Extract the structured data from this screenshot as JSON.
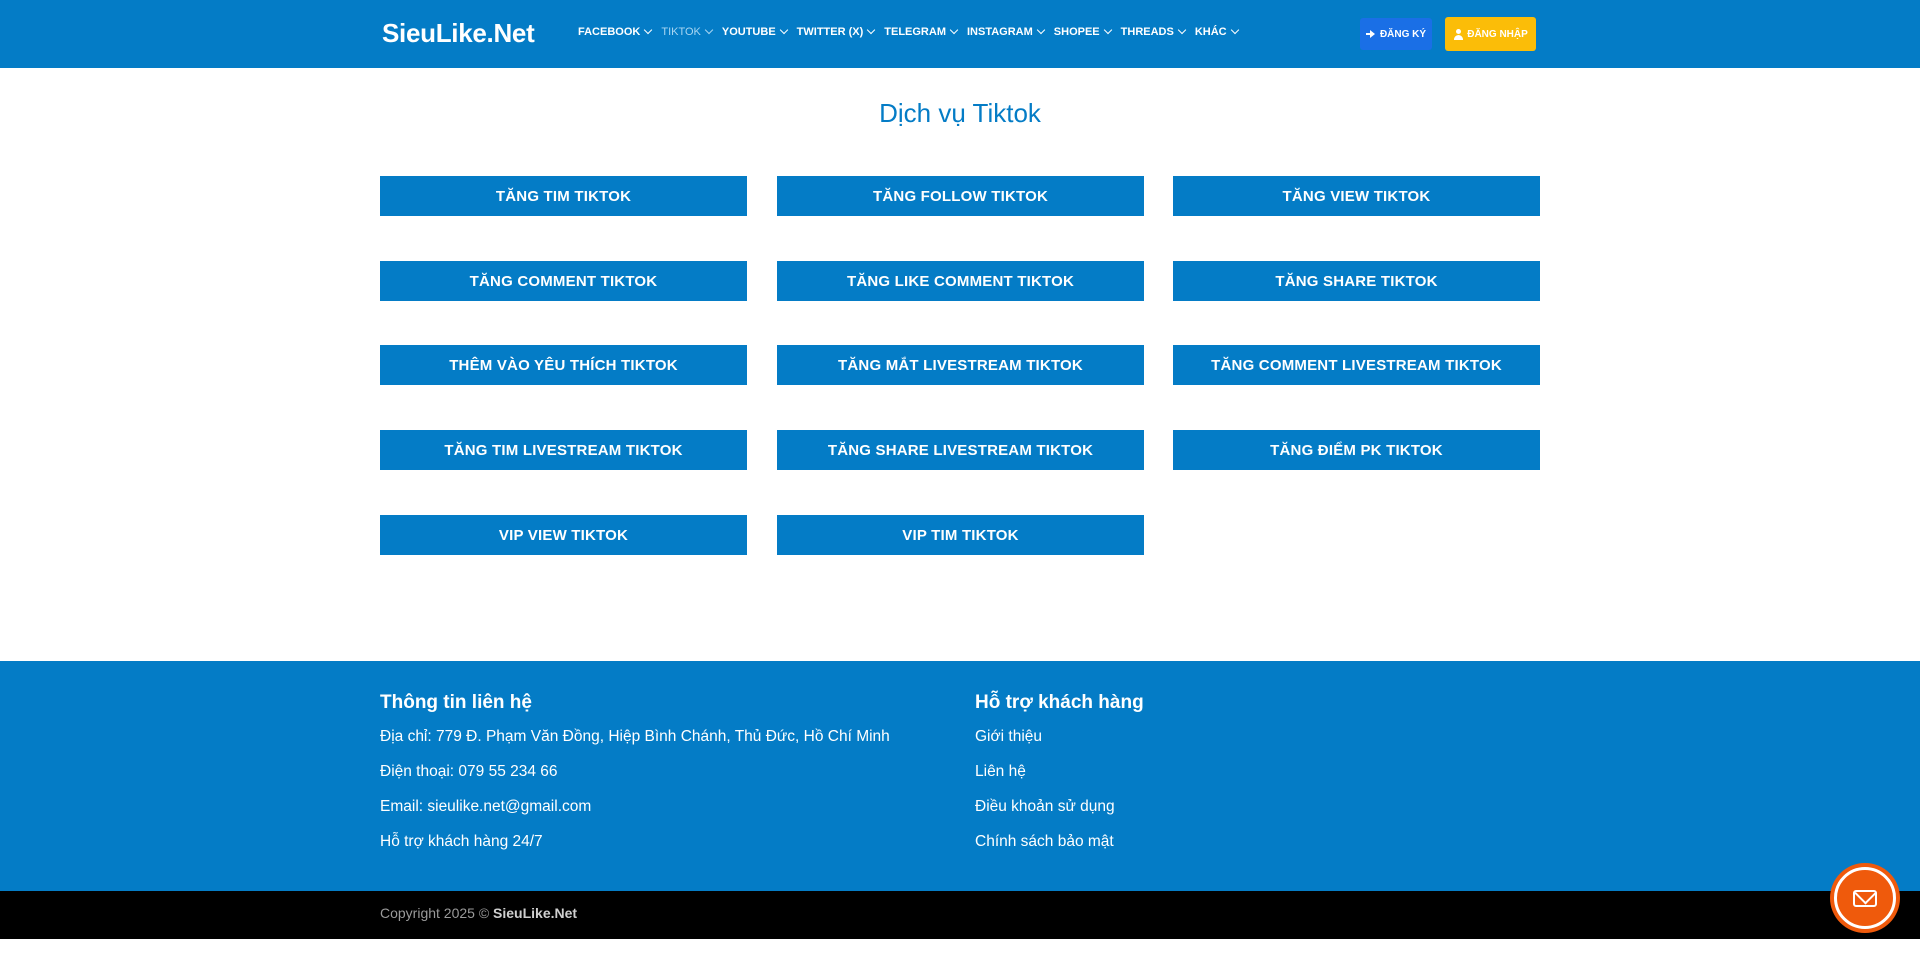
{
  "header": {
    "logo": "SieuLike.Net",
    "nav": [
      {
        "label": "FACEBOOK",
        "active": false
      },
      {
        "label": "TIKTOK",
        "active": true
      },
      {
        "label": "YOUTUBE",
        "active": false
      },
      {
        "label": "TWITTER (X)",
        "active": false
      },
      {
        "label": "TELEGRAM",
        "active": false
      },
      {
        "label": "INSTAGRAM",
        "active": false
      },
      {
        "label": "SHOPEE",
        "active": false
      },
      {
        "label": "THREADS",
        "active": false
      },
      {
        "label": "KHÁC",
        "active": false
      }
    ],
    "register_label": "ĐĂNG KÝ",
    "login_label": "ĐĂNG NHẬP"
  },
  "main": {
    "title": "Dịch vụ Tiktok",
    "services": [
      "TĂNG TIM TIKTOK",
      "TĂNG FOLLOW TIKTOK",
      "TĂNG VIEW TIKTOK",
      "TĂNG COMMENT TIKTOK",
      "TĂNG LIKE COMMENT TIKTOK",
      "TĂNG SHARE TIKTOK",
      "THÊM VÀO YÊU THÍCH TIKTOK",
      "TĂNG MẮT LIVESTREAM TIKTOK",
      "TĂNG COMMENT LIVESTREAM TIKTOK",
      "TĂNG TIM LIVESTREAM TIKTOK",
      "TĂNG SHARE LIVESTREAM TIKTOK",
      "TĂNG ĐIỂM PK TIKTOK",
      "VIP VIEW TIKTOK",
      "VIP TIM TIKTOK"
    ]
  },
  "footer": {
    "contact_title": "Thông tin liên hệ",
    "contact_lines": [
      "Địa chỉ: 779 Đ. Phạm Văn Đồng, Hiệp Bình Chánh, Thủ Đức, Hồ Chí Minh",
      "Điện thoại: 079 55 234 66",
      "Email: sieulike.net@gmail.com",
      "Hỗ trợ khách hàng 24/7"
    ],
    "support_title": "Hỗ trợ khách hàng",
    "support_links": [
      "Giới thiệu",
      "Liên hệ",
      "Điều khoản sử dụng",
      "Chính sách bảo mật"
    ],
    "copyright_prefix": "Copyright 2025 ©",
    "copyright_brand": "SieuLike.Net"
  },
  "colors": {
    "brand_blue": "#047cc6",
    "register_blue": "#1a6fe6",
    "login_yellow": "#fbbd08",
    "chat_orange": "#ef5a0c",
    "bottom_bar": "#000000"
  },
  "icons": {
    "register": "sign-in-icon",
    "login": "user-icon",
    "nav_dropdown": "chevron-down-icon",
    "chat": "mail-icon"
  }
}
